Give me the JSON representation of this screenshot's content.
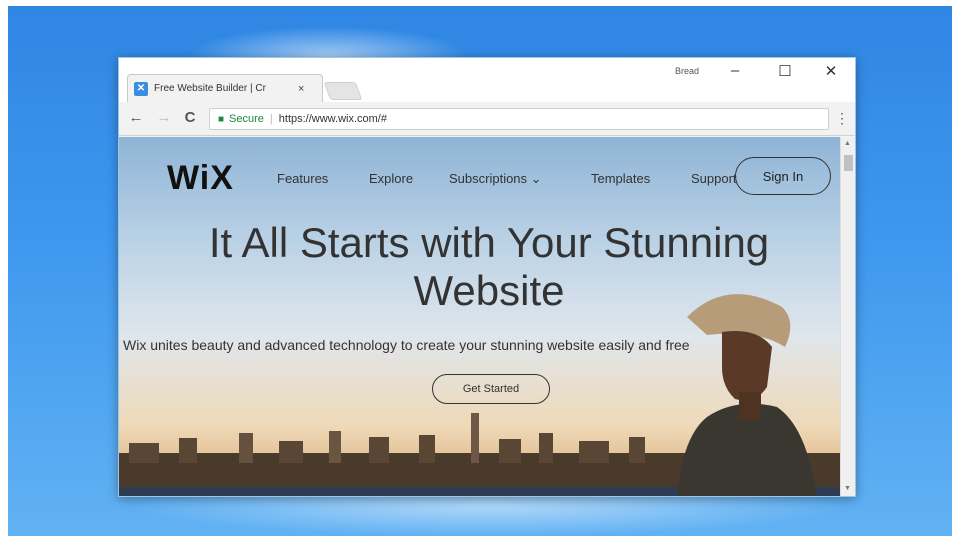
{
  "browser": {
    "tab_title": "Free Website Builder | Cr",
    "tab_close": "×",
    "profile_label": "Bread",
    "window_controls": {
      "minimize": "–",
      "maximize": "☐",
      "close": "✕"
    },
    "nav": {
      "back": "←",
      "forward": "→",
      "reload": "C"
    },
    "address": {
      "secure_label": "Secure",
      "url": "https://www.wix.com/#"
    },
    "menu": "⋮"
  },
  "site": {
    "logo": "WiX",
    "nav": [
      "Features",
      "Explore",
      "Subscriptions ⌄",
      "Templates",
      "Support"
    ],
    "signin": "Sign In",
    "headline_line1": "It All Starts with Your Stunning",
    "headline_line2": "Website",
    "subheadline": "Wix unites beauty and advanced technology to create your stunning website easily and free",
    "cta": "Get Started"
  },
  "colors": {
    "desktop_blue": "#3e98ee",
    "secure_green": "#1b8a3a",
    "favicon_blue": "#3a8ee0"
  },
  "icons": [
    "wix-favicon",
    "back-arrow-icon",
    "forward-arrow-icon",
    "reload-icon",
    "lock-icon",
    "kebab-menu-icon",
    "chevron-down-icon"
  ]
}
